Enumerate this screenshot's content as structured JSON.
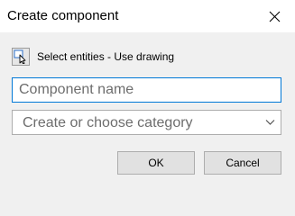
{
  "dialog": {
    "title": "Create component"
  },
  "select": {
    "label": "Select entities - Use drawing",
    "icon": "select-entities-icon"
  },
  "name_field": {
    "value": "",
    "placeholder": "Component name"
  },
  "category_select": {
    "value": "Create or choose category",
    "icon": "chevron-down-icon"
  },
  "buttons": {
    "ok_label": "OK",
    "cancel_label": "Cancel"
  },
  "colors": {
    "accent_focus": "#0078d7",
    "dialog_background": "#f0f0f0",
    "titlebar_background": "#ffffff",
    "button_background": "#e1e1e1"
  }
}
